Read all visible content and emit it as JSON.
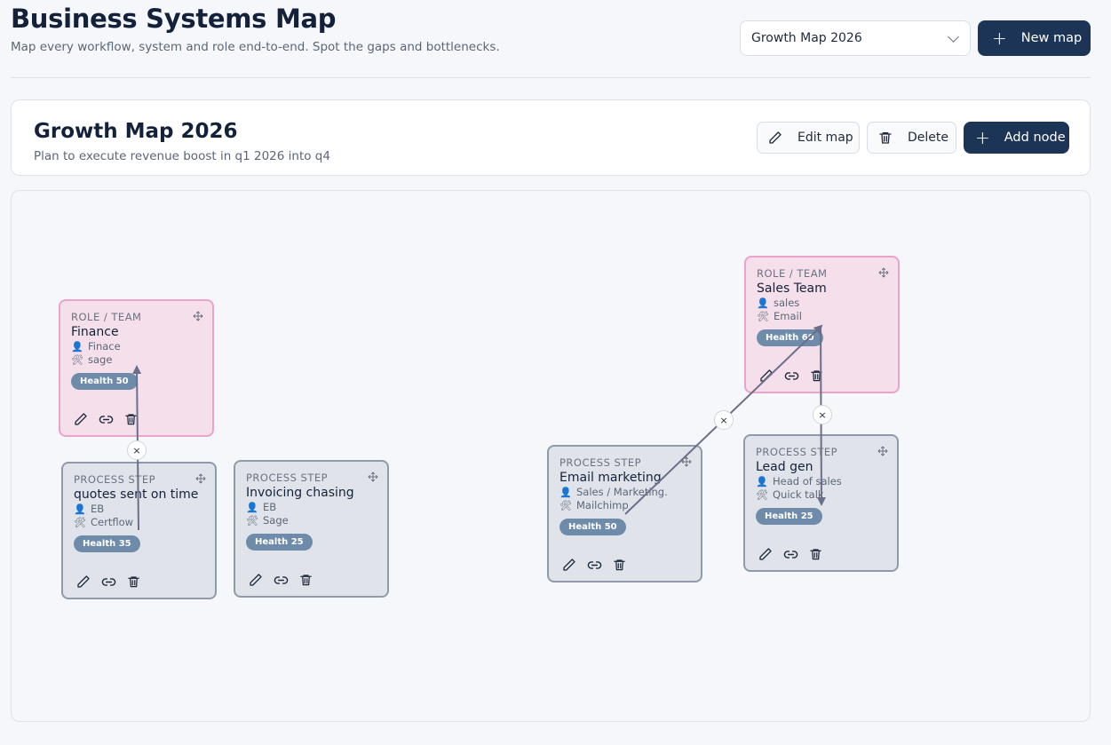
{
  "header": {
    "title": "Business Systems Map",
    "subtitle": "Map every workflow, system and role end-to-end. Spot the gaps and bottlenecks.",
    "map_selector_value": "Growth Map 2026",
    "new_map_label": "New map"
  },
  "map": {
    "name": "Growth Map 2026",
    "description": "Plan to execute revenue boost in q1 2026 into q4",
    "edit_label": "Edit map",
    "delete_label": "Delete",
    "add_node_label": "Add node"
  },
  "nodes": [
    {
      "type": "ROLE / TEAM",
      "name": "Finance",
      "person": "Finace",
      "tool": "sage",
      "health": "Health 50",
      "kind": "role"
    },
    {
      "type": "PROCESS STEP",
      "name": "quotes sent on time",
      "person": "EB",
      "tool": "Certflow",
      "health": "Health 35",
      "kind": "process"
    },
    {
      "type": "PROCESS STEP",
      "name": "Invoicing chasing",
      "person": "EB",
      "tool": "Sage",
      "health": "Health 25",
      "kind": "process"
    },
    {
      "type": "PROCESS STEP",
      "name": "Email marketing",
      "person": "Sales / Marketing.",
      "tool": "Mailchimp",
      "health": "Health 50",
      "kind": "process"
    },
    {
      "type": "ROLE / TEAM",
      "name": "Sales Team",
      "person": "sales",
      "tool": "Email",
      "health": "Health 60",
      "kind": "role"
    },
    {
      "type": "PROCESS STEP",
      "name": "Lead gen",
      "person": "Head of sales",
      "tool": "Quick talk",
      "health": "Health 25",
      "kind": "process"
    }
  ],
  "edge_remove_glyph": "×",
  "colors": {
    "primary": "#1c3557",
    "role_bg": "#f4dfeb",
    "role_border": "#eaa3cb",
    "process_bg": "#e0e4ea",
    "process_border": "#8f9bab",
    "health_badge": "#6e8caa",
    "edge": "#6b6f8a"
  }
}
